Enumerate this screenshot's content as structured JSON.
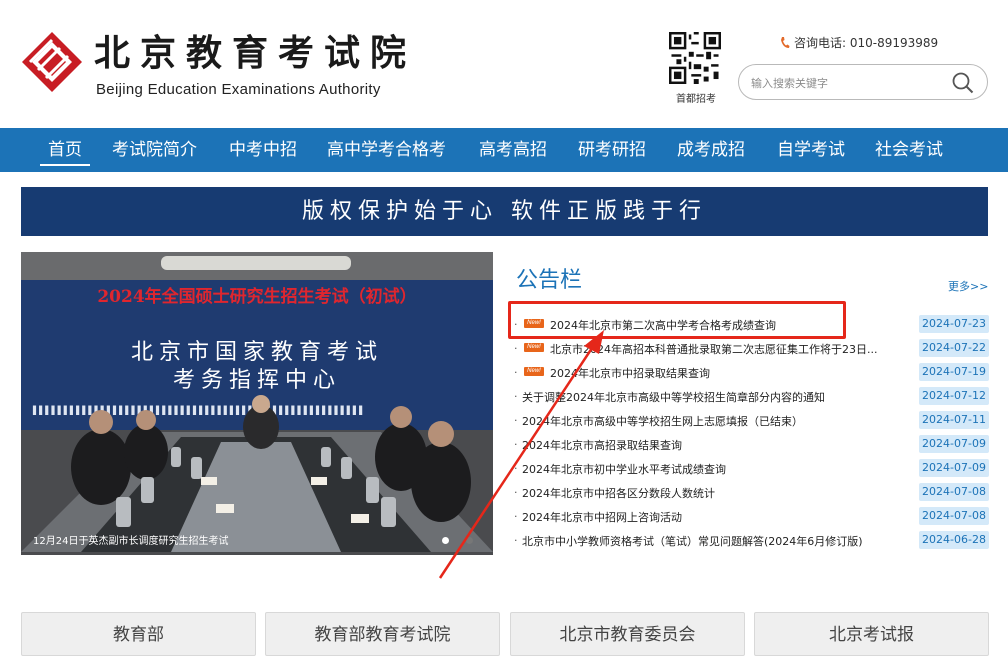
{
  "header": {
    "logo_cn": "北京教育考试院",
    "logo_en": "Beijing Education Examinations Authority",
    "qr_label": "首都招考",
    "phone_label": "咨询电话: 010-89193989",
    "search_placeholder": "输入搜索关键字"
  },
  "nav": {
    "items": [
      {
        "label": "首页",
        "active": true
      },
      {
        "label": "考试院简介"
      },
      {
        "label": "中考中招"
      },
      {
        "label": "高中学考合格考"
      },
      {
        "label": "高考高招"
      },
      {
        "label": "研考研招"
      },
      {
        "label": "成考成招"
      },
      {
        "label": "自学考试"
      },
      {
        "label": "社会考试"
      }
    ]
  },
  "banner": {
    "text": "版权保护始于心 软件正版践于行"
  },
  "photo": {
    "headline": "2024年全国硕士研究生招生考试（初试）",
    "wall_line1": "北京市国家教育考试",
    "wall_line2": "考务指挥中心",
    "caption": "12月24日于英杰副市长调度研究生招生考试"
  },
  "board": {
    "title": "公告栏",
    "more": "更多>>",
    "new_badge": "New!",
    "notices": [
      {
        "title": "2024年北京市第二次高中学考合格考成绩查询",
        "date": "2024-07-23",
        "is_new": true
      },
      {
        "title": "北京市2024年高招本科普通批录取第二次志愿征集工作将于23日...",
        "date": "2024-07-22",
        "is_new": true
      },
      {
        "title": "2024年北京市中招录取结果查询",
        "date": "2024-07-19",
        "is_new": true
      },
      {
        "title": "关于调整2024年北京市高级中等学校招生简章部分内容的通知",
        "date": "2024-07-12"
      },
      {
        "title": "2024年北京市高级中等学校招生网上志愿填报（已结束）",
        "date": "2024-07-11"
      },
      {
        "title": "2024年北京市高招录取结果查询",
        "date": "2024-07-09"
      },
      {
        "title": "2024年北京市初中学业水平考试成绩查询",
        "date": "2024-07-09"
      },
      {
        "title": "2024年北京市中招各区分数段人数统计",
        "date": "2024-07-08"
      },
      {
        "title": "2024年北京市中招网上咨询活动",
        "date": "2024-07-08"
      },
      {
        "title": "北京市中小学教师资格考试（笔试）常见问题解答(2024年6月修订版)",
        "date": "2024-06-28"
      }
    ]
  },
  "links": [
    "教育部",
    "教育部教育考试院",
    "北京市教育委员会",
    "北京考试报"
  ],
  "colors": {
    "nav_blue": "#1c73b7",
    "banner_navy": "#173b72",
    "annotation_red": "#e5271a",
    "date_bg": "#d4e9f9"
  }
}
